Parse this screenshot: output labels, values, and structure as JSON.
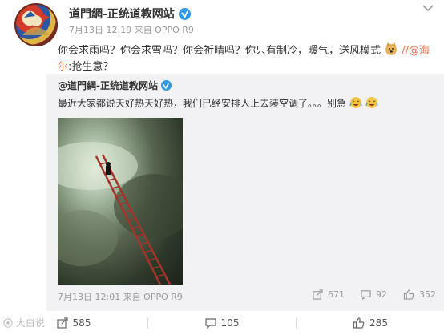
{
  "post": {
    "user": "道門網-正统道教网站",
    "meta": "7月13日 12:19 来自 OPPO R9",
    "text_before": "你会求雨吗？你会求雪吗？你会祈晴吗？你只有制冷，暖气，送风模式",
    "link_text": "//@海尔",
    "text_after": ":抢生意？"
  },
  "repost": {
    "user": "@道門網-正统道教网站",
    "text": "最近大家都说天好热天好热，我们已经安排人上去装空调了。。。别急",
    "meta": "7月13日 12:01 来自 OPPO R9",
    "share_count": "671",
    "comment_count": "92",
    "like_count": "352"
  },
  "bottom": {
    "share_count": "585",
    "comment_count": "105",
    "like_count": "285",
    "watermark": "大白说"
  },
  "colors": {
    "link": "#eb7350",
    "verified": "#2f98e8",
    "repost_bg": "#f2f2f5"
  }
}
